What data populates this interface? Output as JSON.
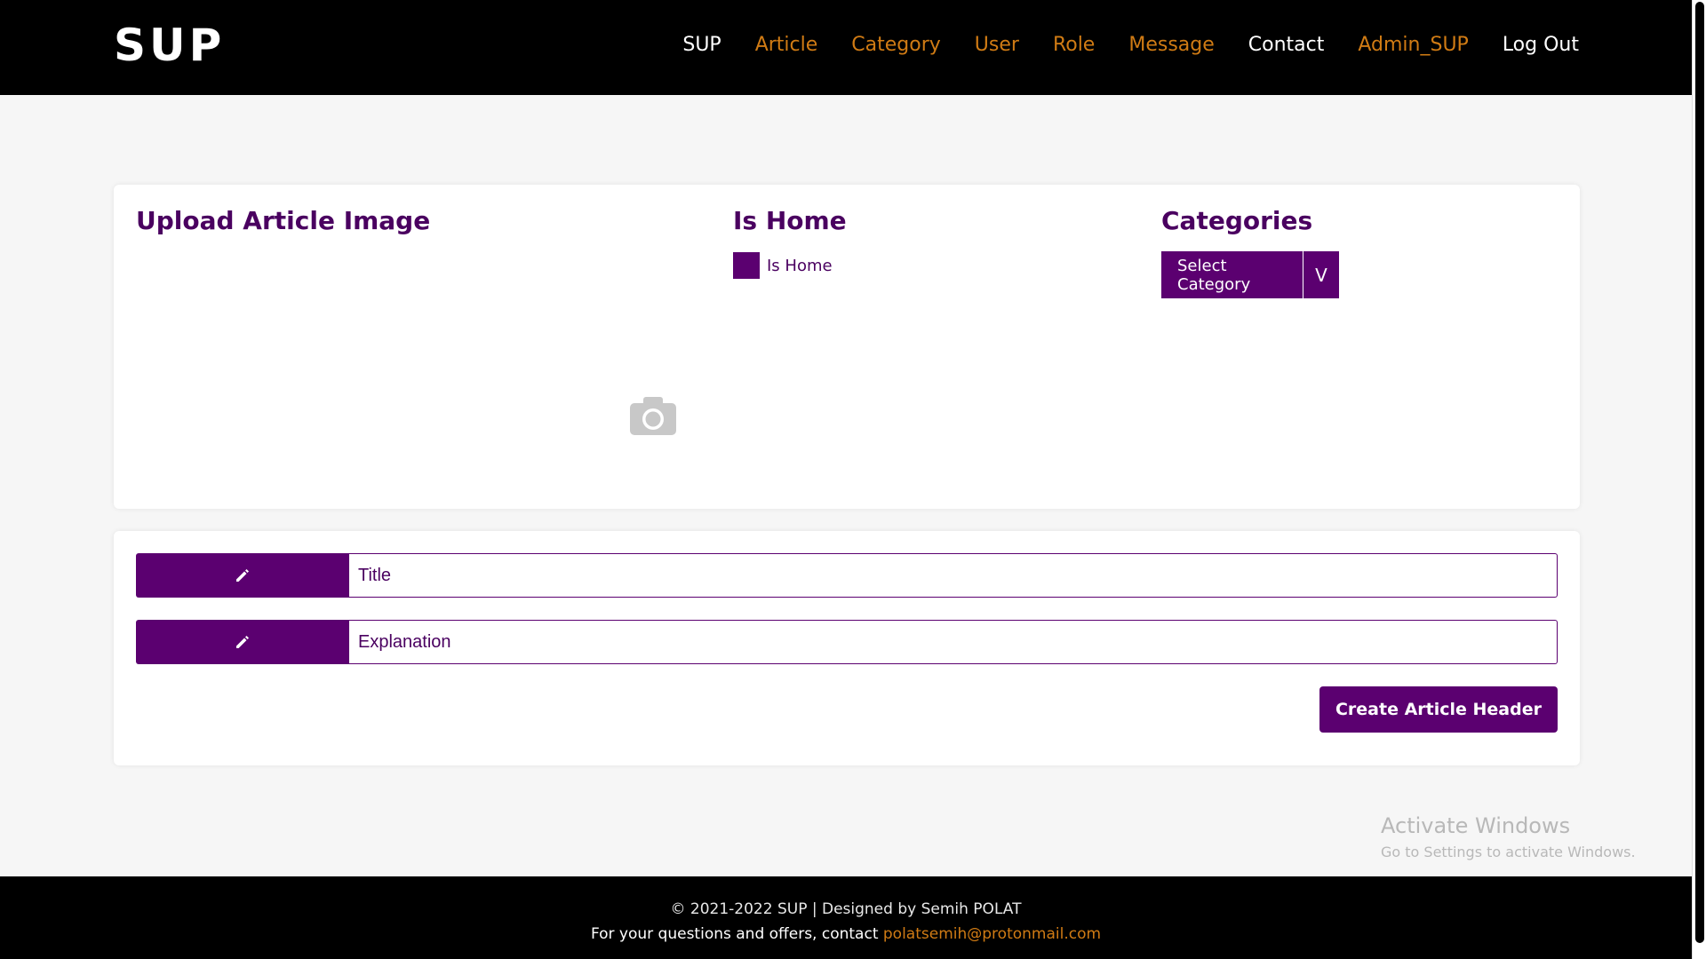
{
  "brand": "SUP",
  "nav": {
    "items": [
      {
        "label": "SUP"
      },
      {
        "label": "Article"
      },
      {
        "label": "Category"
      },
      {
        "label": "User"
      },
      {
        "label": "Role"
      },
      {
        "label": "Message"
      },
      {
        "label": "Contact"
      },
      {
        "label": "Admin_SUP"
      },
      {
        "label": "Log Out"
      }
    ],
    "colors": {
      "accent": "#d07b14",
      "default": "#ffffff"
    }
  },
  "upload": {
    "title": "Upload Article Image",
    "icon": "camera-icon"
  },
  "is_home": {
    "title": "Is Home",
    "checkbox_label": "Is Home"
  },
  "categories": {
    "title": "Categories",
    "select_label": "Select Category",
    "arrow_label": "V"
  },
  "form": {
    "title_placeholder": "Title",
    "explanation_placeholder": "Explanation",
    "edit_icon": "pencil-icon",
    "submit_label": "Create Article Header"
  },
  "watermark": {
    "line1": "Activate Windows",
    "line2": "Go to Settings to activate Windows."
  },
  "footer": {
    "line1": "© 2021-2022 SUP | Designed by Semih POLAT",
    "line2_prefix": "For your questions and offers, contact ",
    "email": "polatsemih@protonmail.com"
  },
  "colors": {
    "primary": "#5b0070",
    "heading": "#4a0060",
    "background": "#f6f6f6",
    "navbar": "#000000"
  }
}
